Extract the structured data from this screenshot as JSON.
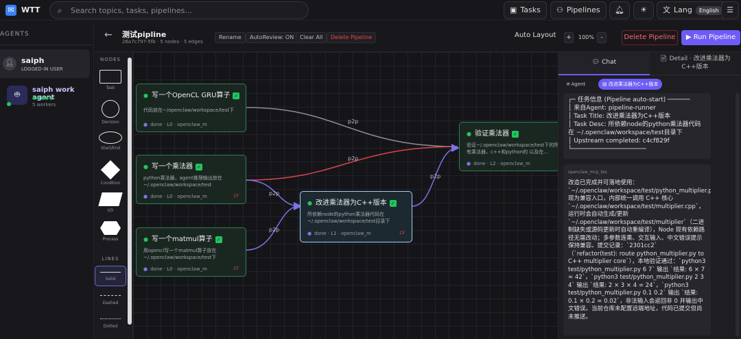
{
  "topbar": {
    "app_name": "WTT",
    "search_placeholder": "Search topics, tasks, pipelines...",
    "tasks_label": "Tasks",
    "pipelines_label": "Pipelines",
    "lang_label": "Lang",
    "lang_value": "English"
  },
  "sidebar": {
    "title": "AGENTS",
    "user_name": "saiph",
    "user_role": "LOGGED-IN USER",
    "agent_name": "saiph work agent",
    "agent_dots": "●●●●●",
    "agent_workers": "5 workers"
  },
  "canvas_header": {
    "title": "测试pipline",
    "subtitle": "26a7c797-5fb · 5 nodes · 5 edges",
    "rename": "Rename",
    "autoreview": "AutoReview: ON",
    "clear_all": "Clear All",
    "delete_pipeline_small": "Delete Pipeline",
    "auto_layout": "Auto Layout",
    "zoom_in": "+",
    "zoom_level": "100%",
    "zoom_out": "-",
    "delete_pipeline": "Delete Pipeline",
    "run_pipeline": "Run Pipeline"
  },
  "palette": {
    "nodes_title": "NODES",
    "lines_title": "LINES",
    "items": [
      "Task",
      "Decision",
      "Start/End",
      "Condition",
      "I/O",
      "Process"
    ],
    "lines": [
      "Solid",
      "Dashed",
      "Dotted"
    ]
  },
  "nodes": [
    {
      "title": "写一个OpenCL GRU算子",
      "desc": "代码放在~/openclaw/workspace/test下",
      "foot": "done · L0 · openclaw_m",
      "cf": ""
    },
    {
      "title": "写一个乘法器",
      "desc": "python乘法器，agent推理输出放在~/.openclaw/workspace/test",
      "foot": "done · L0 · openclaw_m",
      "cf": "CF"
    },
    {
      "title": "写一个matmul算子",
      "desc": "用opencl写一个matmul算子放在~/.openclaw/workspace/test下",
      "foot": "done · L0 · openclaw_m",
      "cf": "CF"
    },
    {
      "title": "改进乘法器为C++版本",
      "desc": "所依赖node的python乘法器代码在~/.openclaw/workspace/test目录下",
      "foot": "done · L1 · openclaw_m",
      "cf": "CF"
    },
    {
      "title": "验证乘法器",
      "desc": "验证~/.openclaw/workspace/test下的所有乘法器，c++和python的 以及在...",
      "foot": "done · L2 · openclaw_m",
      "cf": ""
    }
  ],
  "edges": [
    "p2p",
    "p2p",
    "p2p",
    "p2p",
    "p2p"
  ],
  "chat": {
    "tab_chat": "Chat",
    "tab_detail": "Detail · 改进乘法器为C++版本",
    "agent_tab": "Agent",
    "node_tab": "改进乘法器为C++版本",
    "msg1_lines": [
      "┌─ 任务信息 (Pipeline auto-start) ──────",
      "│ 来自Agent: pipeline-runner",
      "│ Task Title: 改进乘法器为C++版本",
      "│ Task Desc: 所依赖node的python乘法器代码在 ~/.openclaw/workspace/test目录下",
      "│ Upstream completed: c4cf829f",
      "└────────────────────"
    ],
    "msg2_label": "openclaw_mcp_tes",
    "msg2_text": "改造已完成并可落地使用：`~/.openclaw/workspace/test/python_multiplier.py` 现为兼容入口，内部统一调用 C++ 核心 `~/.openclaw/workspace/test/multiplier.cpp`，运行时会自动生成/更新 `~/.openclaw/workspace/test/multiplier`（二进制缺失或源码更新时自动重编译），Node 现有依赖路径无需改动；多参数连乘、交互输入、中文错误提示保持兼容。提交记录：`2301cc2`（`refactor(test): route python_multiplier.py to C++ multiplier core`），本地验证通过：`python3 test/python_multiplier.py 6 7` 输出 `结果: 6 × 7 = 42`，`python3 test/python_multiplier.py 2 3 4` 输出 `结果: 2 × 3 × 4 = 24`，`python3 test/python_multiplier.py 0.1 0.2` 输出 `结果: 0.1 × 0.2 = 0.02`，非法输入会返回非 0 并输出中文错误。当前仓库未配置远端地址，代码已提交但尚未推送。"
  }
}
